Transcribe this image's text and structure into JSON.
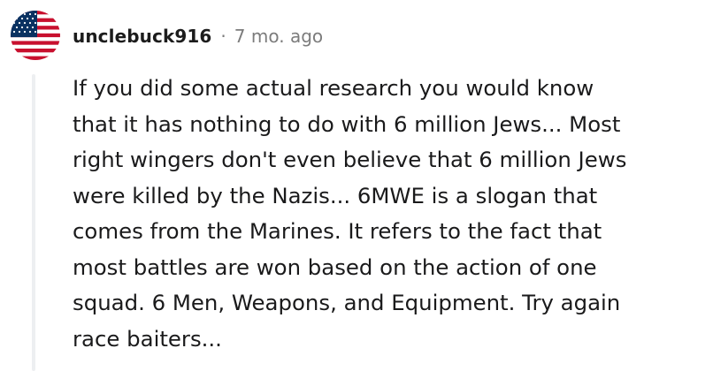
{
  "comment": {
    "avatar_icon": "us-flag-icon",
    "username": "unclebuck916",
    "separator": "·",
    "timestamp": "7 mo. ago",
    "body": "If you did some actual research you would know\nthat it has nothing to do with 6 million Jews... Most\nright wingers don't even believe that 6 million Jews\nwere killed by the Nazis... 6MWE is a slogan that\ncomes from the Marines. It refers to the fact that\nmost battles are won based on the action of one\nsquad. 6 Men, Weapons, and Equipment. Try again\nrace baiters..."
  },
  "colors": {
    "flag_red": "#c8102e",
    "flag_blue": "#0a3161",
    "flag_white": "#ffffff",
    "thread_line": "#edeff1",
    "meta_gray": "#7c7c7c",
    "text": "#1a1a1b"
  }
}
